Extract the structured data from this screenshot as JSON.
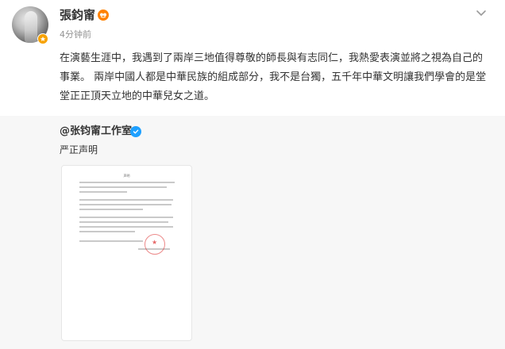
{
  "post": {
    "username": "張鈞甯",
    "timestamp": "4分钟前",
    "content": "在演藝生涯中，我遇到了兩岸三地值得尊敬的師長與有志同仁，我熱愛表演並將之視為自己的事業。 兩岸中國人都是中華民族的組成部分，我不是台獨，五千年中華文明讓我們學會的是堂堂正正頂天立地的中華兒女之道。",
    "avatar_icon": "user-avatar-icon",
    "badge_color": "#f7a200",
    "level_badge_color": "#ff8200"
  },
  "repost": {
    "author": "@张钧甯工作室",
    "text": "严正声明",
    "verified_color": "#1ea0ff",
    "doc_title": "声明"
  }
}
